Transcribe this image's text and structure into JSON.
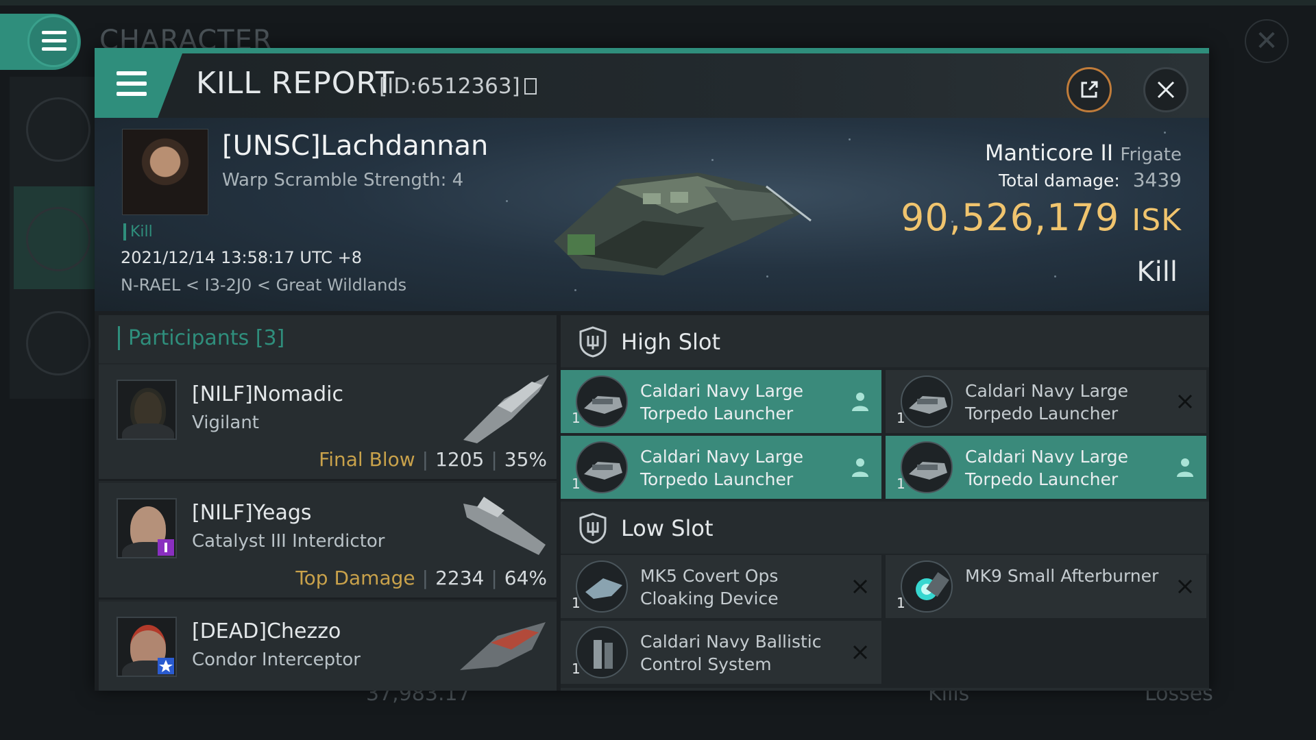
{
  "background": {
    "window_title": "CHARACTER",
    "bottom_stats": {
      "isk": "37,983.17",
      "kills_label": "Kills",
      "losses_label": "Losses"
    }
  },
  "header": {
    "title": "KILL REPORT",
    "report_id": "[ID:6512363]"
  },
  "victim": {
    "name": "[UNSC]Lachdannan",
    "subtitle": "Warp Scramble Strength: 4",
    "tag": "Kill",
    "datetime": "2021/12/14 13:58:17 UTC +8",
    "location": "N-RAEL < I3-2J0 < Great Wildlands",
    "ship_name": "Manticore II",
    "ship_class": "Frigate",
    "total_damage_label": "Total damage:",
    "total_damage": "3439",
    "isk_value": "90,526,179",
    "isk_unit": "ISK",
    "result": "Kill"
  },
  "participants": {
    "title": "Participants [3]",
    "rows": [
      {
        "name": "[NILF]Nomadic",
        "ship": "Vigilant",
        "tag": "Final Blow",
        "damage": "1205",
        "percent": "35%"
      },
      {
        "name": "[NILF]Yeags",
        "ship": "Catalyst III Interdictor",
        "tag": "Top Damage",
        "damage": "2234",
        "percent": "64%"
      },
      {
        "name": "[DEAD]Chezzo",
        "ship": "Condor Interceptor"
      }
    ]
  },
  "fittings": {
    "high_slot": {
      "title": "High Slot",
      "modules": [
        {
          "name": "Caldari Navy Large Torpedo Launcher",
          "qty": "1",
          "state": "dropped"
        },
        {
          "name": "Caldari Navy Large Torpedo Launcher",
          "qty": "1",
          "state": "destroyed"
        },
        {
          "name": "Caldari Navy Large Torpedo Launcher",
          "qty": "1",
          "state": "dropped"
        },
        {
          "name": "Caldari Navy Large Torpedo Launcher",
          "qty": "1",
          "state": "dropped"
        }
      ]
    },
    "low_slot": {
      "title": "Low Slot",
      "modules": [
        {
          "name": "MK5 Covert Ops Cloaking Device",
          "qty": "1",
          "state": "destroyed"
        },
        {
          "name": "MK9 Small Afterburner",
          "qty": "1",
          "state": "destroyed"
        },
        {
          "name": "Caldari Navy Ballistic Control System",
          "qty": "1",
          "state": "destroyed"
        }
      ]
    }
  },
  "colors": {
    "accent": "#2f8e7c",
    "isk": "#f0c46e",
    "tag_gold": "#c9a24b",
    "dropped_module": "#3a8a7b"
  }
}
